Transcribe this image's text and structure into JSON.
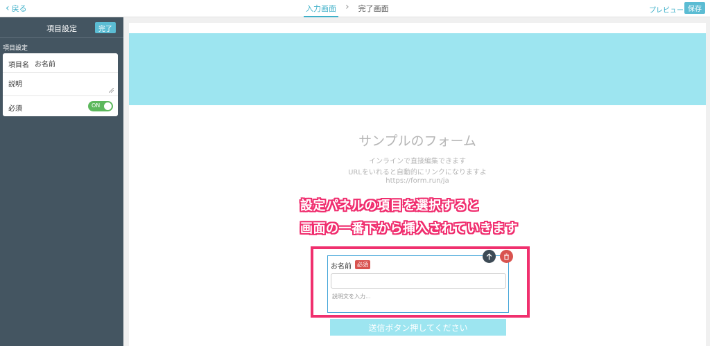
{
  "topbar": {
    "back_label": "戻る",
    "steps": [
      {
        "label": "入力画面",
        "active": true
      },
      {
        "label": "完了画面",
        "active": false
      }
    ],
    "preview_label": "プレビュー",
    "save_label": "保存"
  },
  "sidebar": {
    "title": "項目設定",
    "done_label": "完了",
    "section_label": "項目設定",
    "fields": {
      "name_label": "項目名",
      "name_value": "お名前",
      "description_label": "説明",
      "required_label": "必須",
      "required_toggle": "ON"
    }
  },
  "form": {
    "title": "サンプルのフォーム",
    "subtitle_lines": [
      "インラインで直接編集できます",
      "URLをいれると自動的にリンクになりますよ",
      "https://form.run/ja"
    ],
    "field": {
      "label": "お名前",
      "required_badge": "必須",
      "description_placeholder": "説明文を入力..."
    },
    "submit_label": "送信ボタン押してください"
  },
  "annotation": {
    "line1": "設定パネルの項目を選択すると",
    "line2": "画面の一番下から挿入されていきます"
  },
  "colors": {
    "accent": "#3fb0c9",
    "sidebar_bg": "#445561",
    "banner": "#9de5f0",
    "annotation": "#f02d6e",
    "toggle_on": "#5cb85c",
    "delete": "#d9534f"
  }
}
